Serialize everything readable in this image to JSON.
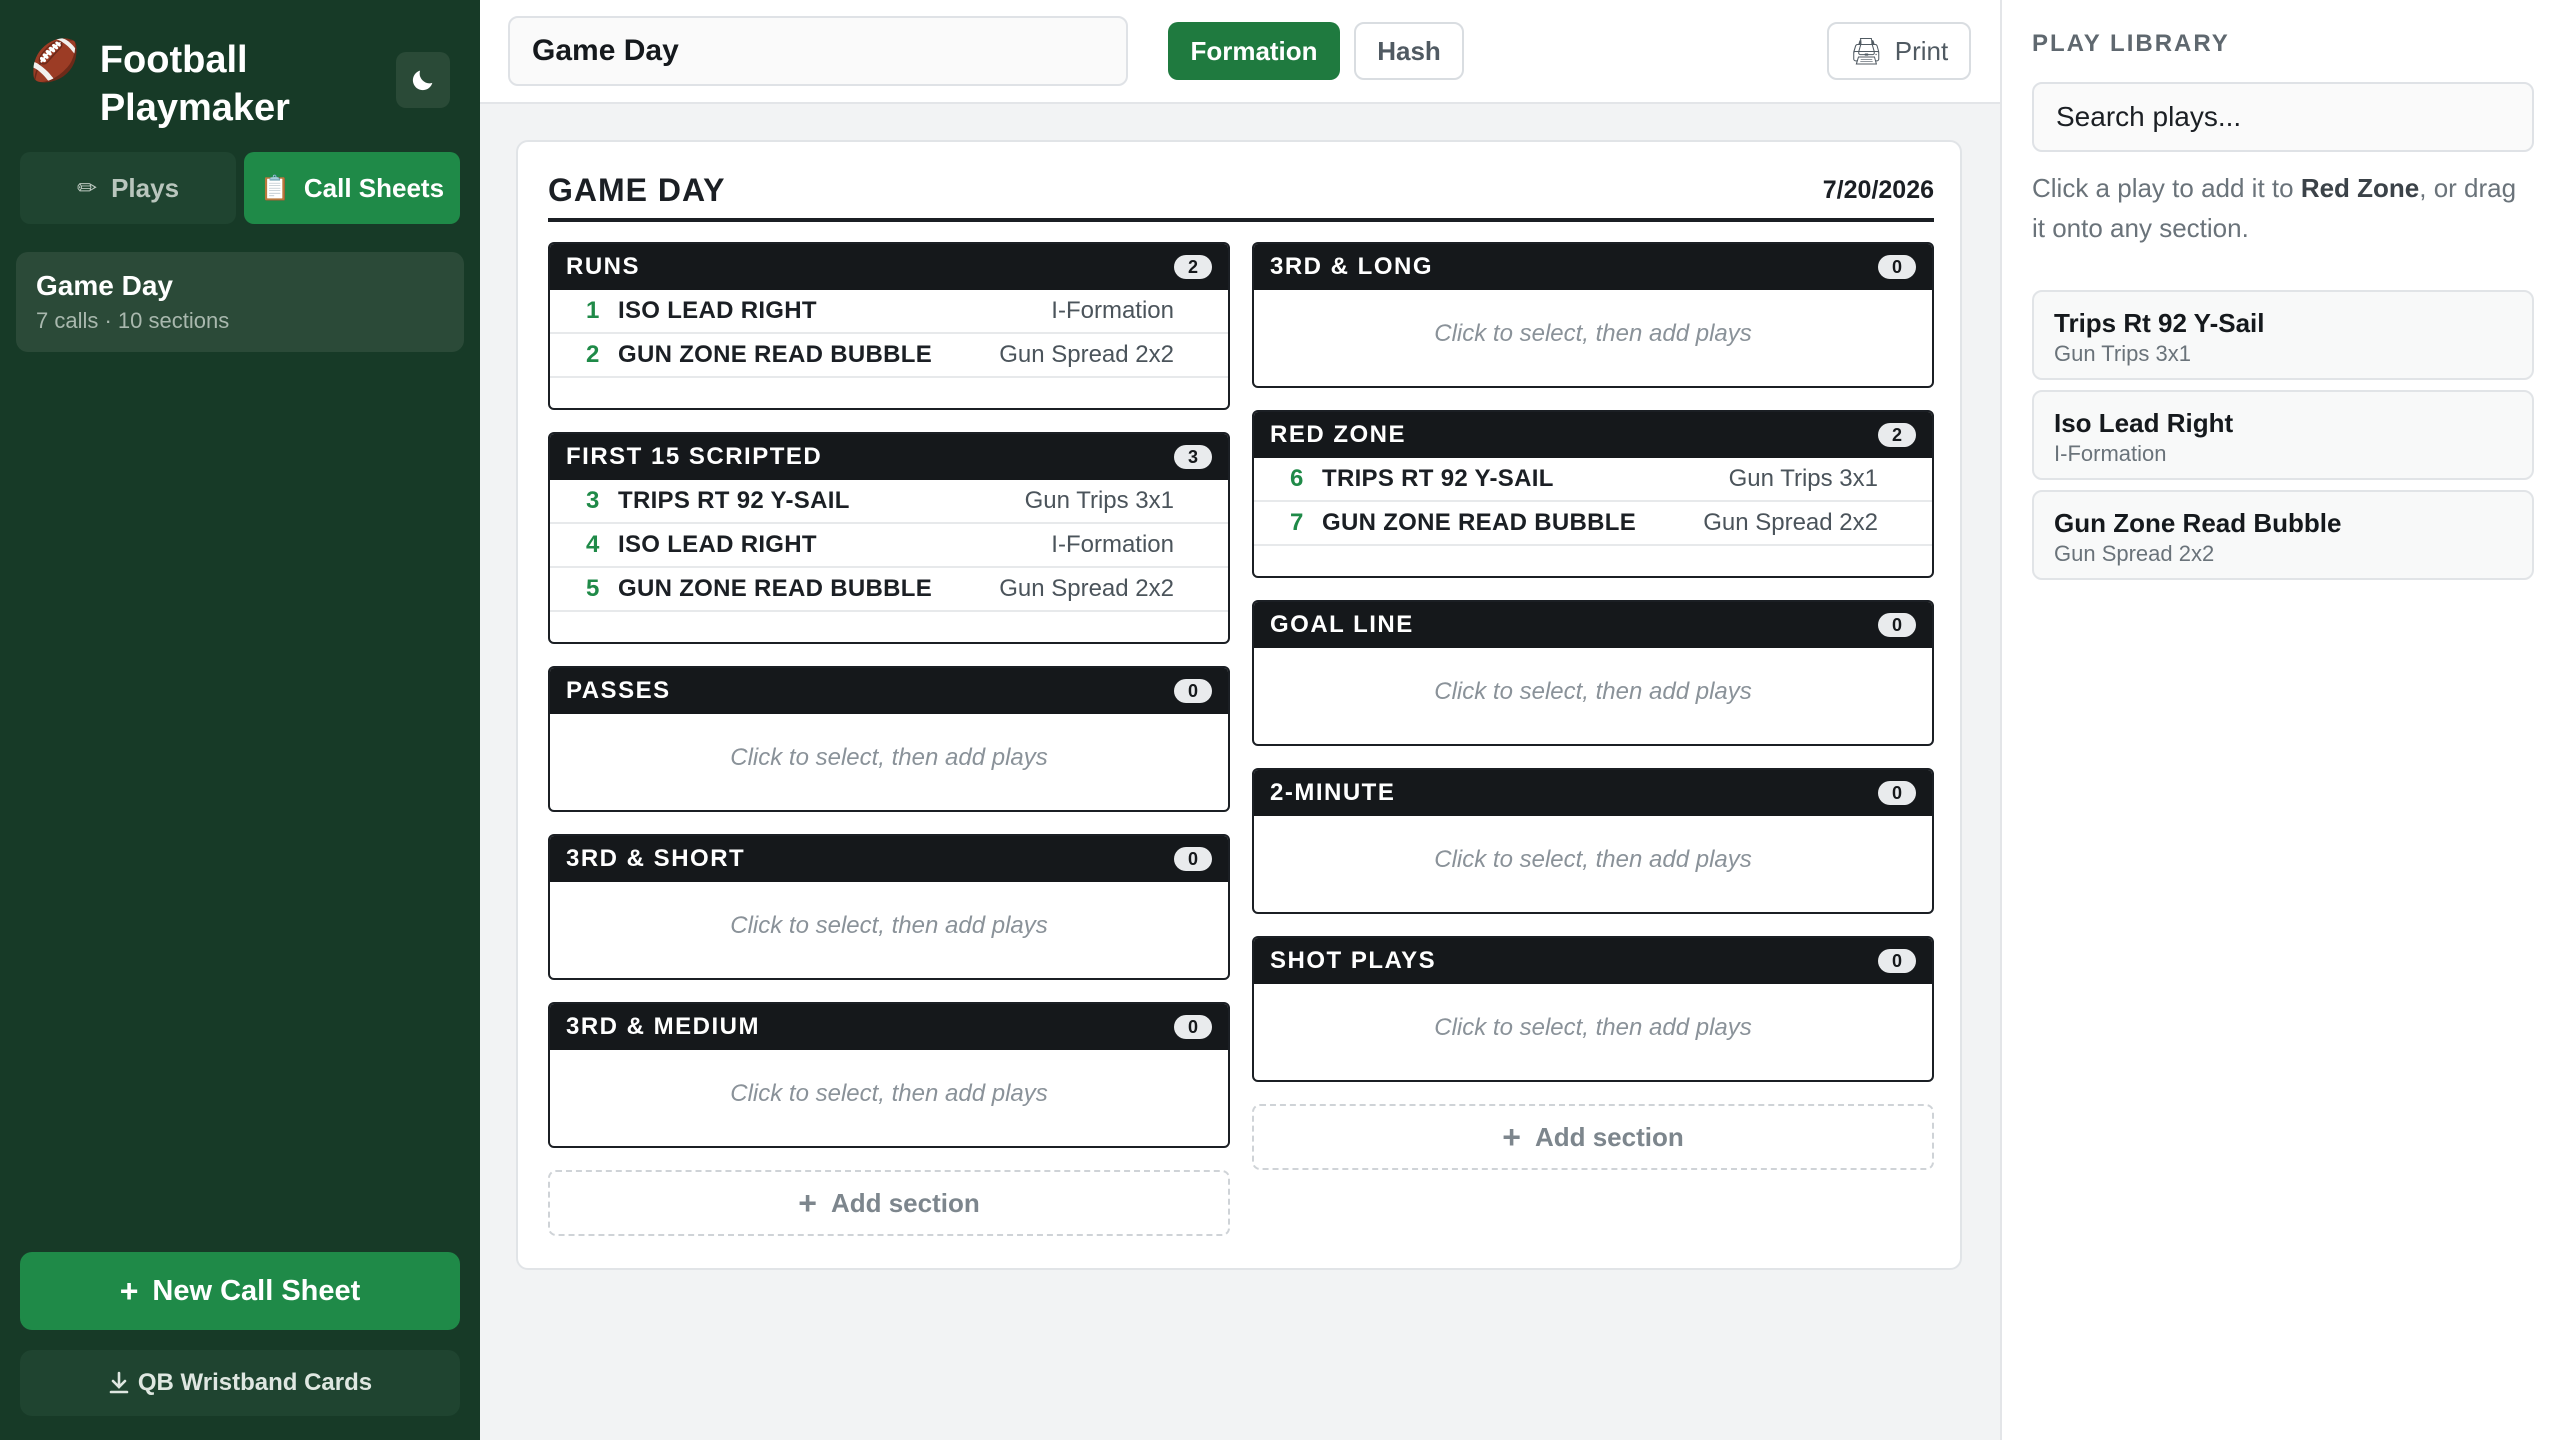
{
  "app": {
    "name_line1": "Football",
    "name_line2": "Playmaker",
    "ball_icon": "football-icon",
    "theme_icon": "moon-icon"
  },
  "nav": {
    "plays_label": "Plays",
    "call_sheets_label": "Call Sheets"
  },
  "call_sheets": [
    {
      "name": "Game Day",
      "meta": "7 calls · 10 sections"
    }
  ],
  "sidebar_actions": {
    "new_call_sheet": "New Call Sheet",
    "wristband": "QB Wristband Cards"
  },
  "toolbar": {
    "title_value": "Game Day",
    "formation_label": "Formation",
    "hash_label": "Hash",
    "print_label": "Print"
  },
  "sheet": {
    "title": "GAME DAY",
    "date": "7/20/2026",
    "empty_text": "Click to select, then add plays",
    "add_section_label": "Add section",
    "left_sections": [
      {
        "name": "RUNS",
        "count": "2",
        "plays": [
          {
            "num": "1",
            "name": "ISO LEAD RIGHT",
            "formation": "I-Formation"
          },
          {
            "num": "2",
            "name": "GUN ZONE READ BUBBLE",
            "formation": "Gun Spread 2x2"
          }
        ]
      },
      {
        "name": "FIRST 15 SCRIPTED",
        "count": "3",
        "plays": [
          {
            "num": "3",
            "name": "TRIPS RT 92 Y-SAIL",
            "formation": "Gun Trips 3x1"
          },
          {
            "num": "4",
            "name": "ISO LEAD RIGHT",
            "formation": "I-Formation"
          },
          {
            "num": "5",
            "name": "GUN ZONE READ BUBBLE",
            "formation": "Gun Spread 2x2"
          }
        ]
      },
      {
        "name": "PASSES",
        "count": "0",
        "plays": []
      },
      {
        "name": "3RD & SHORT",
        "count": "0",
        "plays": []
      },
      {
        "name": "3RD & MEDIUM",
        "count": "0",
        "plays": []
      }
    ],
    "right_sections": [
      {
        "name": "3RD & LONG",
        "count": "0",
        "plays": []
      },
      {
        "name": "RED ZONE",
        "count": "2",
        "plays": [
          {
            "num": "6",
            "name": "TRIPS RT 92 Y-SAIL",
            "formation": "Gun Trips 3x1"
          },
          {
            "num": "7",
            "name": "GUN ZONE READ BUBBLE",
            "formation": "Gun Spread 2x2"
          }
        ]
      },
      {
        "name": "GOAL LINE",
        "count": "0",
        "plays": []
      },
      {
        "name": "2-MINUTE",
        "count": "0",
        "plays": []
      },
      {
        "name": "SHOT PLAYS",
        "count": "0",
        "plays": []
      }
    ]
  },
  "library": {
    "title": "PLAY LIBRARY",
    "search_placeholder": "Search plays...",
    "hint_pre": "Click a play to add it to ",
    "hint_target": "Red Zone",
    "hint_post": ", or drag it onto any section.",
    "plays": [
      {
        "name": "Trips Rt 92 Y-Sail",
        "formation": "Gun Trips 3x1"
      },
      {
        "name": "Iso Lead Right",
        "formation": "I-Formation"
      },
      {
        "name": "Gun Zone Read Bubble",
        "formation": "Gun Spread 2x2"
      }
    ]
  },
  "colors": {
    "sidebar_bg": "#173a27",
    "accent_green": "#1f8a48",
    "section_header": "#15181b"
  }
}
